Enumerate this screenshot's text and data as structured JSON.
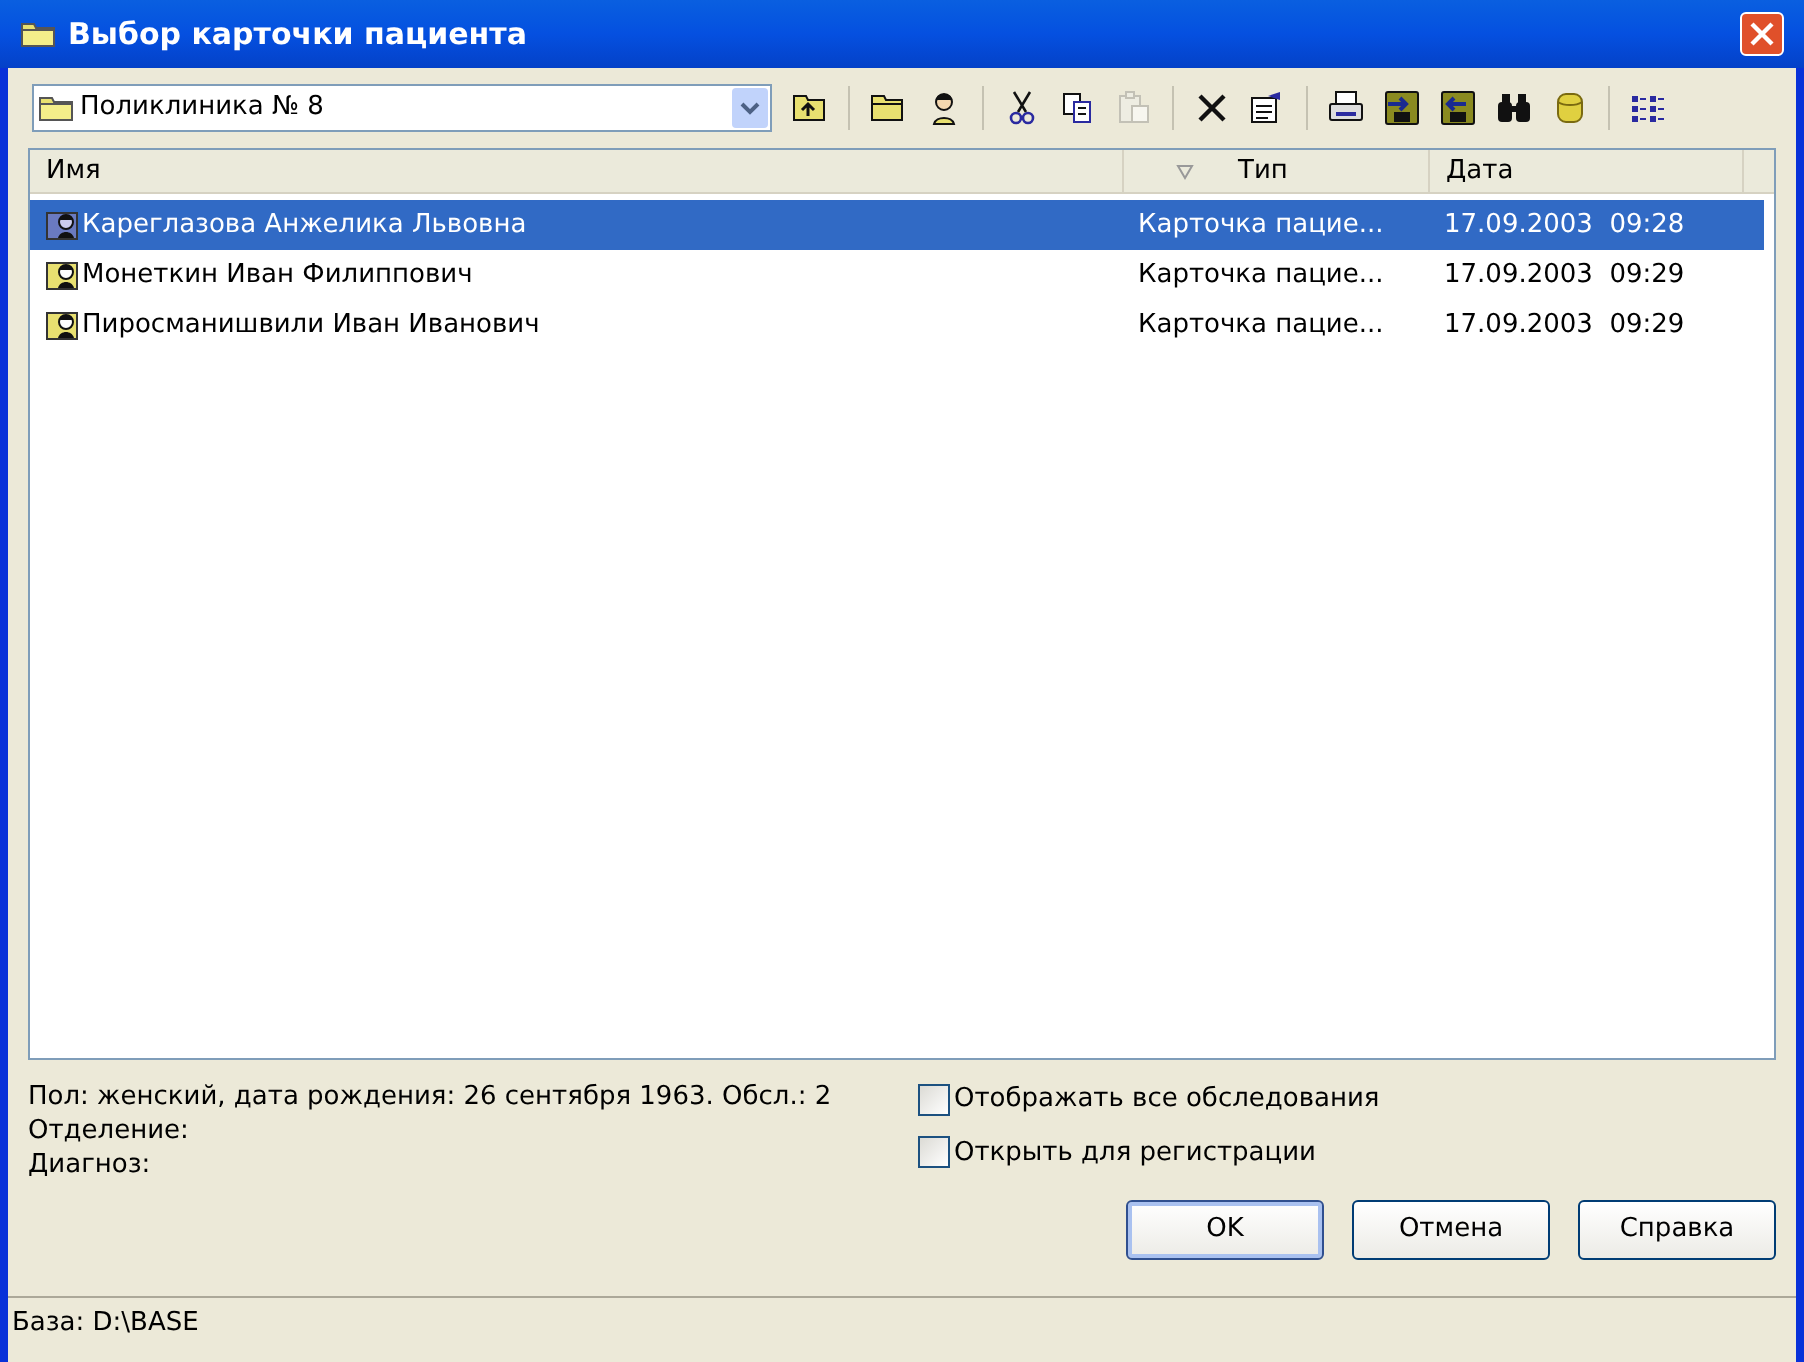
{
  "window": {
    "title": "Выбор карточки пациента"
  },
  "location": {
    "value": "Поликлиника № 8"
  },
  "toolbar": [
    {
      "kind": "folder-up",
      "disabled": false
    },
    {
      "kind": "separator"
    },
    {
      "kind": "new-folder",
      "disabled": false
    },
    {
      "kind": "person",
      "disabled": false
    },
    {
      "kind": "separator"
    },
    {
      "kind": "cut",
      "disabled": false
    },
    {
      "kind": "copy",
      "disabled": false
    },
    {
      "kind": "paste",
      "disabled": true
    },
    {
      "kind": "separator"
    },
    {
      "kind": "delete",
      "disabled": false
    },
    {
      "kind": "properties",
      "disabled": false
    },
    {
      "kind": "separator"
    },
    {
      "kind": "printer",
      "disabled": false
    },
    {
      "kind": "import",
      "disabled": false
    },
    {
      "kind": "export",
      "disabled": false
    },
    {
      "kind": "binoculars",
      "disabled": false
    },
    {
      "kind": "database",
      "disabled": false
    },
    {
      "kind": "separator"
    },
    {
      "kind": "list-view",
      "disabled": false
    }
  ],
  "table": {
    "columns": [
      {
        "label": "Имя",
        "sort": false
      },
      {
        "label": "Тип",
        "sort": true
      },
      {
        "label": "Дата",
        "sort": false
      }
    ],
    "rows": [
      {
        "name": "Кареглазова Анжелика Львовна",
        "type": "Карточка пацие...",
        "date": "17.09.2003  09:28",
        "selected": true
      },
      {
        "name": "Монеткин Иван Филиппович",
        "type": "Карточка пацие...",
        "date": "17.09.2003  09:29",
        "selected": false
      },
      {
        "name": "Пиросманишвили Иван Иванович",
        "type": "Карточка пацие...",
        "date": "17.09.2003  09:29",
        "selected": false
      }
    ]
  },
  "info": [
    "Пол: женский, дата рождения: 26 сентября 1963. Обсл.: 2",
    "Отделение:",
    "Диагноз:"
  ],
  "options": [
    {
      "label": "Отображать все обследования",
      "checked": false
    },
    {
      "label": "Открыть для регистрации",
      "checked": false
    }
  ],
  "buttons": [
    {
      "label": "OK",
      "default": true
    },
    {
      "label": "Отмена",
      "default": false
    },
    {
      "label": "Справка",
      "default": false
    }
  ],
  "status_bar": "База: D:\\BASE"
}
